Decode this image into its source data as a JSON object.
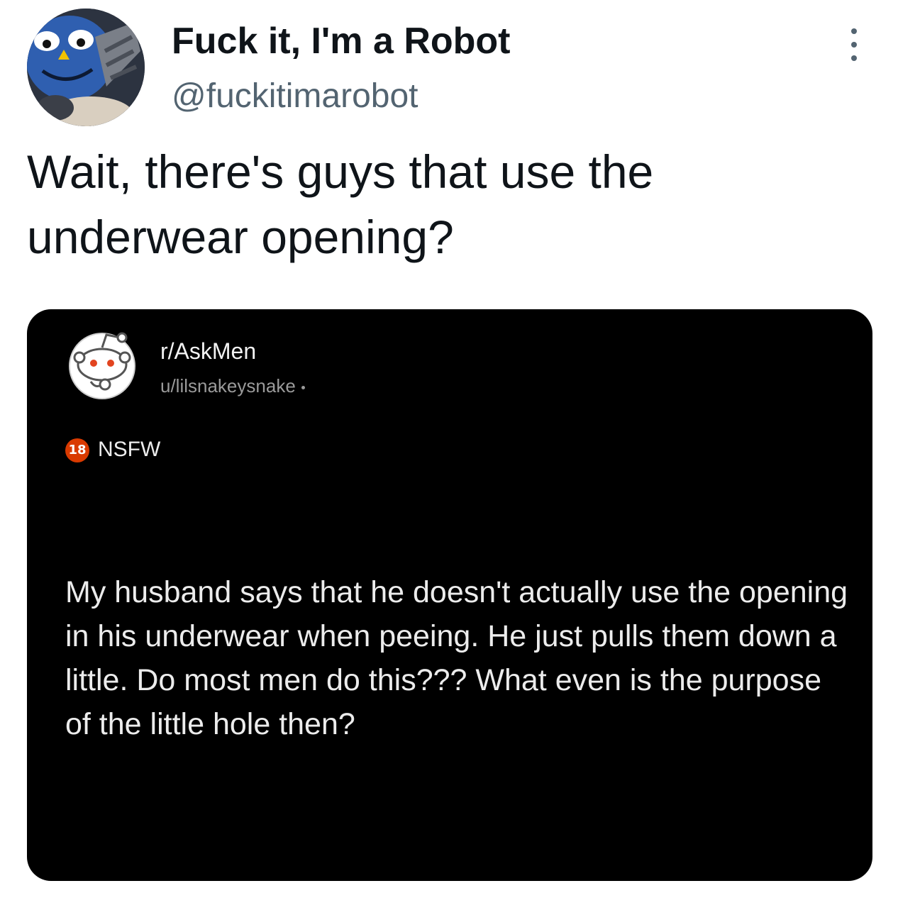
{
  "tweet": {
    "display_name": "Fuck it, I'm a Robot",
    "handle": "@fuckitimarobot",
    "text": "Wait, there's guys that use the underwear opening?",
    "more_icon": "more-vertical-icon"
  },
  "embed": {
    "subreddit": "r/AskMen",
    "author": "u/lilsnakeysnake",
    "nsfw_badge": "18",
    "nsfw_label": "NSFW",
    "post_text": "My husband says that he doesn't actually use the opening in his underwear when peeing. He just pulls them down a little. Do most men do this??? What even is the purpose of the little hole then?",
    "avatar_icon": "reddit-snoo-icon"
  },
  "colors": {
    "name_text": "#0f1419",
    "handle_text": "#536471",
    "embed_background": "#000000",
    "nsfw_red": "#d93a00"
  }
}
